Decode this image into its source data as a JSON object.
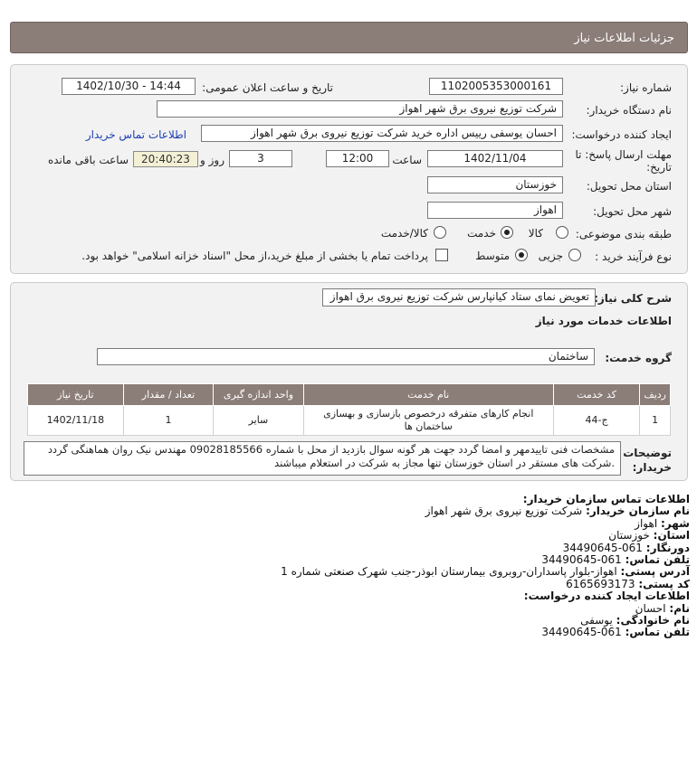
{
  "header": {
    "title": "جزئیات اطلاعات نیاز"
  },
  "form": {
    "need_number_label": "شماره نیاز:",
    "need_number": "1102005353000161",
    "announce_label": "تاریخ و ساعت اعلان عمومی:",
    "announce_value": "1402/10/30 - 14:44",
    "buyer_org_label": "نام دستگاه خریدار:",
    "buyer_org": "شرکت توزیع نیروی برق شهر اهواز",
    "creator_label": "ایجاد کننده درخواست:",
    "creator": "احسان یوسفی رییس اداره خرید شرکت توزیع نیروی برق شهر اهواز",
    "contact_link": "اطلاعات تماس خریدار",
    "deadline_label_1": "مهلت ارسال پاسخ: تا",
    "deadline_label_2": "تاریخ:",
    "deadline_date": "1402/11/04",
    "time_label": "ساعت",
    "deadline_time": "12:00",
    "days_value": "3",
    "days_label": "روز و",
    "remaining_time": "20:40:23",
    "remaining_label": "ساعت باقی مانده",
    "province_label": "استان محل تحویل:",
    "province": "خوزستان",
    "city_label": "شهر محل تحویل:",
    "city": "اهواز",
    "category_label": "طبقه بندی موضوعی:",
    "category_options": [
      "کالا",
      "خدمت",
      "کالا/خدمت"
    ],
    "category_selected": "خدمت",
    "process_label": "نوع فرآیند خرید :",
    "process_options": [
      "جزیی",
      "متوسط"
    ],
    "process_selected": "متوسط",
    "payment_text": "پرداخت تمام یا بخشی از مبلغ خرید،از محل \"اسناد خزانه اسلامی\" خواهد بود."
  },
  "description": {
    "summary_label": "شرح کلی نیاز:",
    "summary": "تعویض نمای ستاد کیانپارس شرکت توزیع نیروی برق اهواز",
    "services_title": "اطلاعات خدمات مورد نیاز",
    "service_group_label": "گروه خدمت:",
    "service_group": "ساختمان",
    "table": {
      "headers": [
        "ردیف",
        "کد خدمت",
        "نام خدمت",
        "واحد اندازه گیری",
        "تعداد / مقدار",
        "تاریخ نیاز"
      ],
      "rows": [
        [
          "1",
          "ج-44",
          "انجام کارهای متفرقه درخصوص بازسازی و بهسازی ساختمان ها",
          "سایر",
          "1",
          "1402/11/18"
        ]
      ]
    },
    "buyer_notes_label_1": "توضیحات",
    "buyer_notes_label_2": "خریدار:",
    "buyer_notes": "مشخصات فنی تاییدمهر و امضا گردد جهت هر گونه سوال بازدید از محل با شماره 09028185566 مهندس نیک روان هماهنگی گردد .شرکت های مستقر در استان خوزستان تنها مجاز به شرکت در استعلام میباشند"
  },
  "contact": {
    "title": "اطلاعات تماس سازمان خریدار:",
    "org_label": "نام سازمان خریدار:",
    "org": "شرکت توزیع نیروی برق شهر اهواز",
    "city_label": "شهر:",
    "city": "اهواز",
    "province_label": "استان:",
    "province": "خوزستان",
    "fax_label": "دورنگار:",
    "fax": "061-34490645",
    "phone_label": "تلفن تماس:",
    "phone": "061-34490645",
    "address_label": "آدرس پستی:",
    "address": "اهواز-بلوار پاسداران-روبروی بیمارستان ابوذر-جنب شهرک صنعتی شماره 1",
    "postal_label": "کد پستی:",
    "postal": "6165693173",
    "creator_title": "اطلاعات ایجاد کننده درخواست:",
    "name_label": "نام:",
    "name": "احسان",
    "family_label": "نام خانوادگی:",
    "family": "یوسفی",
    "creator_phone_label": "تلفن تماس:",
    "creator_phone": "061-34490645"
  }
}
